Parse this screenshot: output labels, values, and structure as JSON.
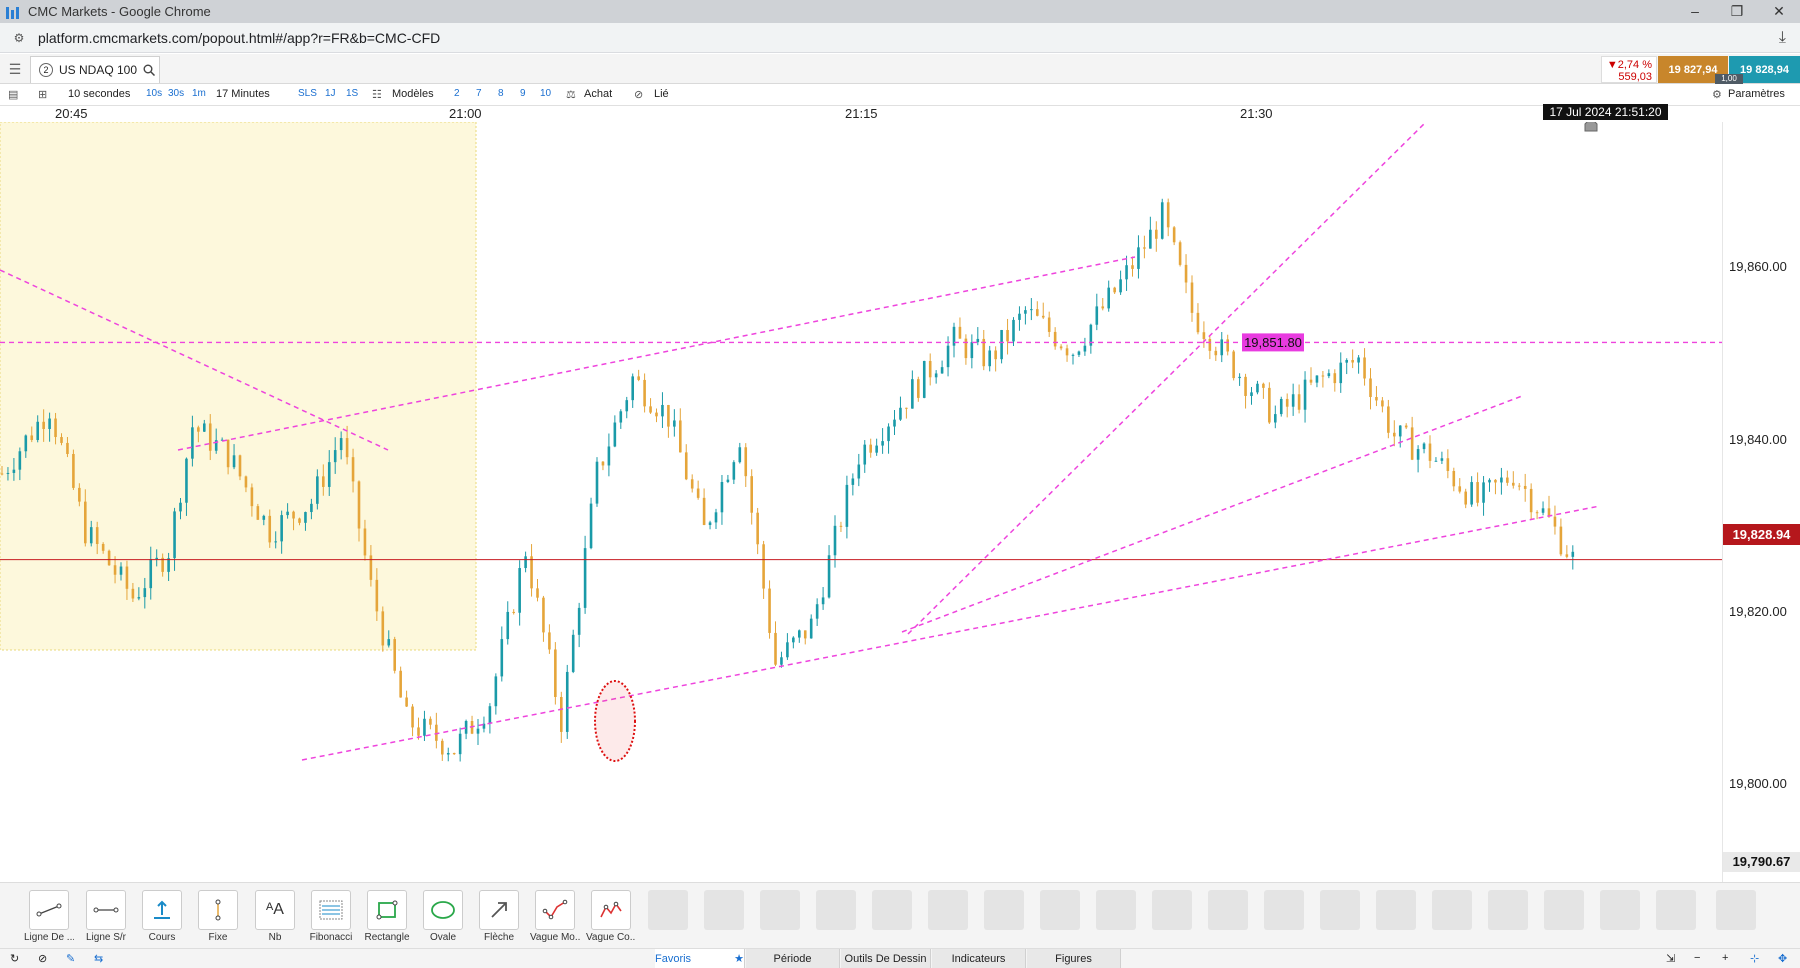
{
  "window": {
    "title": "CMC Markets - Google Chrome",
    "url": "platform.cmcmarkets.com/popout.html#/app?r=FR&b=CMC-CFD"
  },
  "header": {
    "tab_number": "2",
    "instrument": "US NDAQ 100",
    "change_pct": "▼2,74 %",
    "change_abs": "559,03",
    "sell_price": "19 827,94",
    "buy_price": "19 828,94",
    "spread": "1,00"
  },
  "toolbar": {
    "interval": "10 secondes",
    "quick_intervals": [
      "10s",
      "30s",
      "1m"
    ],
    "zoom": "17 Minutes",
    "quick_ranges": [
      "SLS",
      "1J",
      "1S"
    ],
    "templates": "Modèles",
    "numbers": [
      "2",
      "7",
      "8",
      "9",
      "10"
    ],
    "trade": "Achat",
    "linked": "Lié",
    "settings": "Paramètres"
  },
  "time_axis": [
    "20:45",
    "21:00",
    "21:15",
    "21:30"
  ],
  "crosshair_time": "17 Jul 2024 21:51:20",
  "price_axis": [
    "19,860.00",
    "19,840.00",
    "19,820.00",
    "19,800.00"
  ],
  "current_price_label": "19,828.94",
  "low_price_label": "19,790.67",
  "level_label": "19,851.80",
  "colors": {
    "bull": "#1a9aa8",
    "bear": "#e5a53a",
    "trend": "#ee44dd",
    "price_line": "#c71c22",
    "session": "#fdf8dc"
  },
  "chart_data": {
    "type": "candlestick",
    "title": "",
    "instrument": "US NDAQ 100",
    "interval": "10 secondes",
    "x_ticks": [
      "20:45",
      "21:00",
      "21:15",
      "21:30"
    ],
    "y_ticks": [
      19800,
      19820,
      19840,
      19860
    ],
    "ylim": [
      19795,
      19875
    ],
    "last_price": 19828.94,
    "horizontal_level": 19851.8,
    "grid": false,
    "close_path": [
      [
        0,
        19838
      ],
      [
        8,
        19845
      ],
      [
        14,
        19832
      ],
      [
        22,
        19825
      ],
      [
        28,
        19830
      ],
      [
        32,
        19843
      ],
      [
        38,
        19840
      ],
      [
        45,
        19832
      ],
      [
        52,
        19835
      ],
      [
        57,
        19842
      ],
      [
        62,
        19826
      ],
      [
        68,
        19812
      ],
      [
        76,
        19809
      ],
      [
        82,
        19814
      ],
      [
        88,
        19830
      ],
      [
        94,
        19812
      ],
      [
        100,
        19838
      ],
      [
        106,
        19848
      ],
      [
        112,
        19844
      ],
      [
        118,
        19832
      ],
      [
        124,
        19842
      ],
      [
        130,
        19818
      ],
      [
        136,
        19822
      ],
      [
        144,
        19840
      ],
      [
        152,
        19846
      ],
      [
        160,
        19852
      ],
      [
        166,
        19850
      ],
      [
        172,
        19855
      ],
      [
        180,
        19851
      ],
      [
        188,
        19858
      ],
      [
        195,
        19865
      ],
      [
        200,
        19855
      ],
      [
        206,
        19850
      ],
      [
        214,
        19844
      ],
      [
        222,
        19848
      ],
      [
        228,
        19850
      ],
      [
        234,
        19842
      ],
      [
        240,
        19840
      ],
      [
        248,
        19835
      ],
      [
        254,
        19838
      ],
      [
        260,
        19833
      ],
      [
        264,
        19829
      ]
    ]
  }
}
